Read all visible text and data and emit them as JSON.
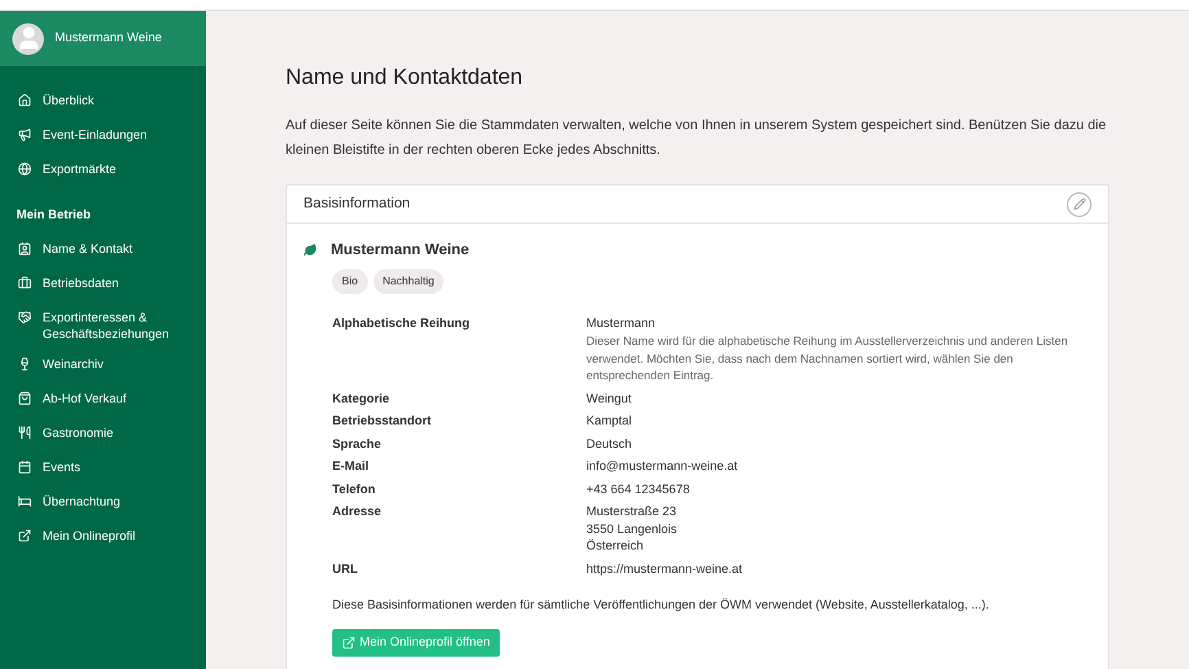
{
  "sidebar": {
    "user": {
      "name": "Mustermann Weine"
    },
    "sections": [
      {
        "items": [
          {
            "label": "Überblick"
          },
          {
            "label": "Event-Einladungen"
          },
          {
            "label": "Exportmärkte"
          }
        ]
      },
      {
        "heading": "Mein Betrieb",
        "items": [
          {
            "label": "Name & Kontakt"
          },
          {
            "label": "Betriebsdaten"
          },
          {
            "label": "Exportinteressen & Geschäftsbeziehungen"
          },
          {
            "label": "Weinarchiv"
          },
          {
            "label": "Ab-Hof Verkauf"
          },
          {
            "label": "Gastronomie"
          },
          {
            "label": "Events"
          },
          {
            "label": "Übernachtung"
          },
          {
            "label": "Mein Onlineprofil"
          }
        ]
      }
    ]
  },
  "page": {
    "title": "Name und Kontaktdaten",
    "intro": "Auf dieser Seite können Sie die Stammdaten verwalten, welche von Ihnen in unserem System gespeichert sind. Benützen Sie dazu die kleinen Bleistifte in der rechten oberen Ecke jedes Abschnitts."
  },
  "card": {
    "title": "Basisinformation",
    "company": "Mustermann Weine",
    "tags": [
      "Bio",
      "Nachhaltig"
    ],
    "fields": [
      {
        "label": "Alphabetische Reihung",
        "lines": [
          "Mustermann"
        ],
        "hint": "Dieser Name wird für die alphabetische Reihung im Ausstellerverzeichnis und anderen Listen verwendet. Möchten Sie, dass nach dem Nachnamen sortiert wird, wählen Sie den entsprechenden Eintrag."
      },
      {
        "label": "Kategorie",
        "lines": [
          "Weingut"
        ]
      },
      {
        "label": "Betriebsstandort",
        "lines": [
          "Kamptal"
        ]
      },
      {
        "label": "Sprache",
        "lines": [
          "Deutsch"
        ]
      },
      {
        "label": "E-Mail",
        "lines": [
          "info@mustermann-weine.at"
        ]
      },
      {
        "label": "Telefon",
        "lines": [
          "+43 664 12345678"
        ]
      },
      {
        "label": "Adresse",
        "lines": [
          "Musterstraße 23",
          "3550 Langenlois",
          "Österreich"
        ]
      },
      {
        "label": "URL",
        "lines": [
          "https://mustermann-weine.at"
        ]
      }
    ],
    "note": "Diese Basisinformationen werden für sämtliche Veröffentlichungen der ÖWM verwendet (Website, Ausstellerkatalog, ...).",
    "button": "Mein Onlineprofil öffnen"
  }
}
